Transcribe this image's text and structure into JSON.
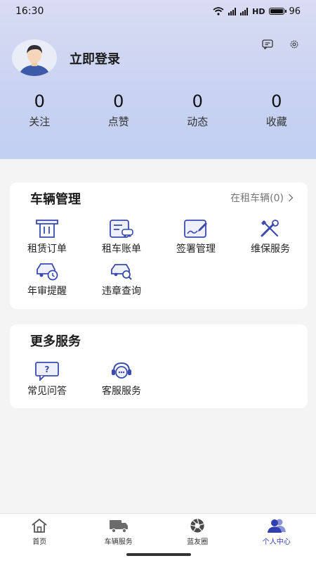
{
  "status_bar": {
    "time": "16:30",
    "network": "HD",
    "battery": "96",
    "battery_level": 0.96
  },
  "profile": {
    "login_label": "立即登录",
    "message_icon": "message-icon",
    "settings_icon": "gear-icon"
  },
  "stats": [
    {
      "value": "0",
      "label": "关注"
    },
    {
      "value": "0",
      "label": "点赞"
    },
    {
      "value": "0",
      "label": "动态"
    },
    {
      "value": "0",
      "label": "收藏"
    }
  ],
  "vehicle_card": {
    "title": "车辆管理",
    "link_label": "在租车辆(0)",
    "items": [
      {
        "label": "租赁订单",
        "icon": "rental-order-icon"
      },
      {
        "label": "租车账单",
        "icon": "rental-bill-icon"
      },
      {
        "label": "签署管理",
        "icon": "sign-icon"
      },
      {
        "label": "维保服务",
        "icon": "maintenance-icon"
      },
      {
        "label": "年审提醒",
        "icon": "annual-inspection-icon"
      },
      {
        "label": "违章查询",
        "icon": "violation-search-icon"
      }
    ]
  },
  "services_card": {
    "title": "更多服务",
    "items": [
      {
        "label": "常见问答",
        "icon": "faq-icon"
      },
      {
        "label": "客服服务",
        "icon": "customer-service-icon"
      }
    ]
  },
  "tabbar": {
    "active": 3,
    "accent": "#2f3fb0",
    "items": [
      {
        "label": "首页",
        "icon": "home-icon"
      },
      {
        "label": "车辆服务",
        "icon": "truck-icon"
      },
      {
        "label": "蓝友圈",
        "icon": "aperture-icon"
      },
      {
        "label": "个人中心",
        "icon": "user-group-icon"
      }
    ]
  }
}
